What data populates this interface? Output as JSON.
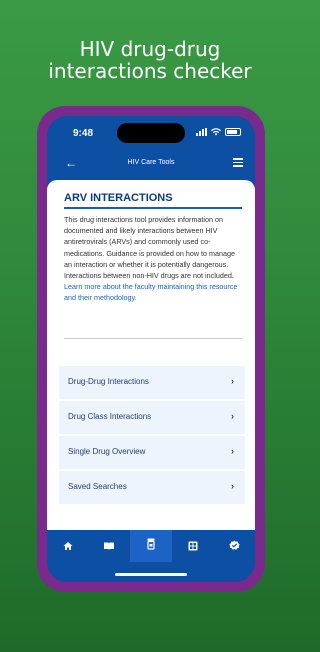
{
  "headline": {
    "line1": "HIV drug-drug",
    "line2": "interactions checker"
  },
  "status_bar": {
    "time": "9:48"
  },
  "app_header": {
    "title": "HIV Care Tools"
  },
  "page": {
    "title": "ARV INTERACTIONS",
    "description": "This drug interactions tool provides information on documented and likely interactions between HIV antiretrovirals (ARVs) and commonly used co-medications. Guidance is provided on how to manage an interaction or whether it is potentially dangerous. Interactions between non-HIV drugs are not included. ",
    "learn_more_link": "Learn more about the faculty maintaining this resource and their methodology."
  },
  "menu": {
    "items": [
      {
        "label": "Drug-Drug Interactions"
      },
      {
        "label": "Drug Class Interactions"
      },
      {
        "label": "Single Drug Overview"
      },
      {
        "label": "Saved Searches"
      }
    ]
  },
  "tab_bar": {
    "tabs": [
      {
        "icon": "home-icon"
      },
      {
        "icon": "book-icon"
      },
      {
        "icon": "pill-bottle-icon",
        "active": true
      },
      {
        "icon": "calculator-icon"
      },
      {
        "icon": "badge-check-icon"
      }
    ]
  },
  "colors": {
    "background_green": "#2f8a3b",
    "frame_purple": "#7a2a8c",
    "app_blue": "#0d4fa3",
    "title_navy": "#0d3a7a",
    "link_blue": "#1a63c2",
    "row_bg": "#eef4fb"
  }
}
